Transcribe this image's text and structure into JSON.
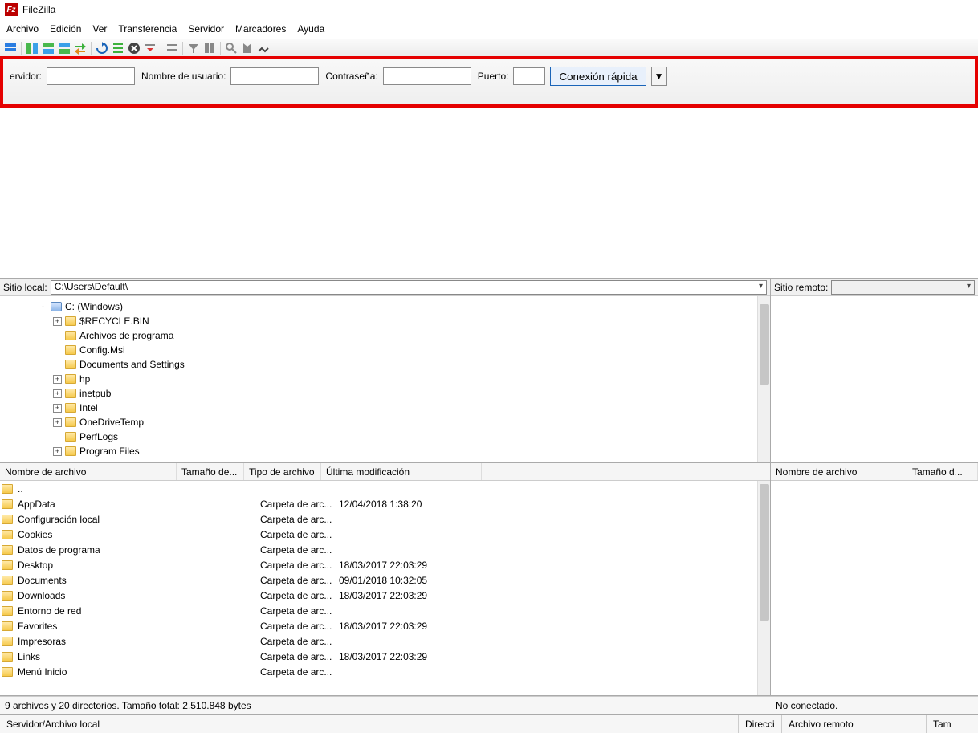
{
  "title": "FileZilla",
  "menu": [
    "Archivo",
    "Edición",
    "Ver",
    "Transferencia",
    "Servidor",
    "Marcadores",
    "Ayuda"
  ],
  "quickconnect": {
    "host_label": "ervidor:",
    "user_label": "Nombre de usuario:",
    "pass_label": "Contraseña:",
    "port_label": "Puerto:",
    "button": "Conexión rápida"
  },
  "local": {
    "label": "Sitio local:",
    "path": "C:\\Users\\Default\\",
    "tree": [
      {
        "indent": 34,
        "toggle": "-",
        "icon": "drive",
        "label": "C: (Windows)"
      },
      {
        "indent": 52,
        "toggle": "+",
        "icon": "folder",
        "label": "$RECYCLE.BIN"
      },
      {
        "indent": 52,
        "toggle": "",
        "icon": "folder",
        "label": "Archivos de programa"
      },
      {
        "indent": 52,
        "toggle": "",
        "icon": "folder",
        "label": "Config.Msi"
      },
      {
        "indent": 52,
        "toggle": "",
        "icon": "folder",
        "label": "Documents and Settings"
      },
      {
        "indent": 52,
        "toggle": "+",
        "icon": "folder",
        "label": "hp"
      },
      {
        "indent": 52,
        "toggle": "+",
        "icon": "folder",
        "label": "inetpub"
      },
      {
        "indent": 52,
        "toggle": "+",
        "icon": "folder",
        "label": "Intel"
      },
      {
        "indent": 52,
        "toggle": "+",
        "icon": "folder",
        "label": "OneDriveTemp"
      },
      {
        "indent": 52,
        "toggle": "",
        "icon": "folder",
        "label": "PerfLogs"
      },
      {
        "indent": 52,
        "toggle": "+",
        "icon": "folder",
        "label": "Program Files"
      }
    ],
    "columns": {
      "name": "Nombre de archivo",
      "size": "Tamaño de...",
      "type": "Tipo de archivo",
      "mod": "Última modificación"
    },
    "files": [
      {
        "name": "..",
        "type": "",
        "mod": ""
      },
      {
        "name": "AppData",
        "type": "Carpeta de arc...",
        "mod": "12/04/2018 1:38:20"
      },
      {
        "name": "Configuración local",
        "type": "Carpeta de arc...",
        "mod": ""
      },
      {
        "name": "Cookies",
        "type": "Carpeta de arc...",
        "mod": ""
      },
      {
        "name": "Datos de programa",
        "type": "Carpeta de arc...",
        "mod": ""
      },
      {
        "name": "Desktop",
        "type": "Carpeta de arc...",
        "mod": "18/03/2017 22:03:29"
      },
      {
        "name": "Documents",
        "type": "Carpeta de arc...",
        "mod": "09/01/2018 10:32:05"
      },
      {
        "name": "Downloads",
        "type": "Carpeta de arc...",
        "mod": "18/03/2017 22:03:29"
      },
      {
        "name": "Entorno de red",
        "type": "Carpeta de arc...",
        "mod": ""
      },
      {
        "name": "Favorites",
        "type": "Carpeta de arc...",
        "mod": "18/03/2017 22:03:29"
      },
      {
        "name": "Impresoras",
        "type": "Carpeta de arc...",
        "mod": ""
      },
      {
        "name": "Links",
        "type": "Carpeta de arc...",
        "mod": "18/03/2017 22:03:29"
      },
      {
        "name": "Menú Inicio",
        "type": "Carpeta de arc...",
        "mod": ""
      }
    ],
    "status": "9 archivos y 20 directorios. Tamaño total: 2.510.848 bytes"
  },
  "remote": {
    "label": "Sitio remoto:",
    "columns": {
      "name": "Nombre de archivo",
      "size": "Tamaño d..."
    },
    "status": "No conectado."
  },
  "footer": {
    "left": "Servidor/Archivo local",
    "dir": "Direcci",
    "remote": "Archivo remoto",
    "tam": "Tam"
  }
}
